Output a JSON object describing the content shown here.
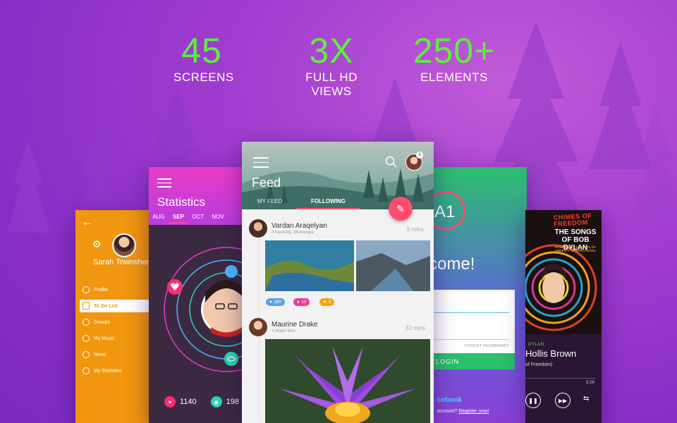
{
  "stats": [
    {
      "number": "45",
      "label": "SCREENS"
    },
    {
      "number": "3X",
      "label": "FULL HD VIEWS"
    },
    {
      "number": "250+",
      "label": "ELEMENTS"
    }
  ],
  "profile": {
    "user_name": "Sarah Townshen",
    "menu": [
      {
        "label": "Profile",
        "icon": "person-icon"
      },
      {
        "label": "To Do List",
        "icon": "calendar-icon",
        "active": true
      },
      {
        "label": "Groups",
        "icon": "groups-icon"
      },
      {
        "label": "My Music",
        "icon": "music-icon"
      },
      {
        "label": "News",
        "icon": "news-icon"
      },
      {
        "label": "My Statistics",
        "icon": "chart-icon"
      }
    ]
  },
  "statistics": {
    "title": "Statistics",
    "months": [
      "AUG",
      "SEP",
      "OCT",
      "NOV"
    ],
    "selected_month": "SEP",
    "likes": "1140",
    "views": "198"
  },
  "feed": {
    "title": "Feed",
    "tabs": [
      "MY FEED",
      "FOLLOWING"
    ],
    "active_tab": "FOLLOWING",
    "notification_count": "3",
    "posts": [
      {
        "author": "Vardan Araqelyan",
        "tags": "# traveling, #Norwegia",
        "time": "5 mins",
        "likes": "280",
        "comments": "15",
        "shares": "5"
      },
      {
        "author": "Maurine Drake",
        "tags": "# Water lilies",
        "time": "32 mins"
      }
    ]
  },
  "welcome": {
    "logo": "A1",
    "heading": "come!",
    "forgot": "FORGOT PASSWORD?",
    "login": "LOGIN",
    "facebook": "cebook",
    "account_text": "account?",
    "register": "Register now!"
  },
  "music": {
    "cover_title": "CHIMES OF FREEDOM",
    "cover_sub": "THE SONGS OF BOB DYLAN",
    "cover_sub2": "HONOURING 50 YEARS OF AMNESTY INTERNATIONAL",
    "artist": "DYLAN",
    "song": "Hollis Brown",
    "album": "of Freedom)",
    "time": "3:29"
  },
  "colors": {
    "stat_green": "#5cf03c",
    "profile_orange": "#f0960f",
    "stats_pink": "#e93cc4",
    "feed_accent": "#ff4d6e",
    "welcome_green": "#2bbf6e"
  }
}
